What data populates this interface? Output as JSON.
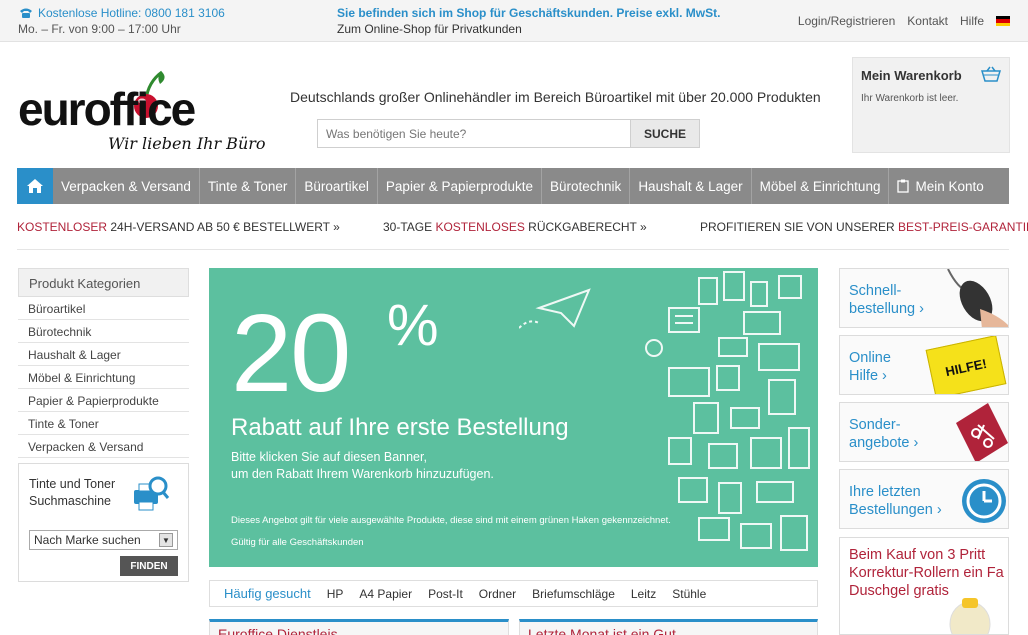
{
  "topbar": {
    "hotline": "Kostenlose Hotline: 0800 181 3106",
    "hours": "Mo. – Fr. von 9:00 – 17:00 Uhr",
    "business_note": "Sie befinden sich im Shop für Geschäftskunden. Preise exkl. MwSt.",
    "private_link": "Zum Online-Shop für Privatkunden",
    "links": [
      "Login/Registrieren",
      "Kontakt",
      "Hilfe"
    ]
  },
  "header": {
    "logo_word": "euroffice",
    "logo_tagline": "Wir lieben Ihr Büro",
    "tagline": "Deutschlands großer Onlinehändler im Bereich Büroartikel mit über 20.000 Produkten",
    "search_placeholder": "Was benötigen Sie heute?",
    "search_button": "SUCHE",
    "cart_title": "Mein Warenkorb",
    "cart_text": "Ihr Warenkorb ist leer."
  },
  "nav": {
    "items": [
      "Verpacken & Versand",
      "Tinte & Toner",
      "Büroartikel",
      "Papier & Papierprodukte",
      "Bürotechnik",
      "Haushalt & Lager",
      "Möbel & Einrichtung"
    ],
    "account": "Mein Konto"
  },
  "usps": [
    {
      "hl": "KOSTENLOSER",
      "rest": " 24H-VERSAND AB 50 € BESTELLWERT »"
    },
    {
      "pre": "30-TAGE ",
      "hl": "KOSTENLOSES",
      "rest": " RÜCKGABERECHT »"
    },
    {
      "pre": "PROFITIEREN SIE VON UNSERER ",
      "hl": "BEST-PREIS-GARANTIE",
      "rest": " »"
    }
  ],
  "sidebar": {
    "title": "Produkt Kategorien",
    "items": [
      "Büroartikel",
      "Bürotechnik",
      "Haushalt & Lager",
      "Möbel & Einrichtung",
      "Papier & Papierprodukte",
      "Tinte & Toner",
      "Verpacken & Versand"
    ],
    "ink_title_1": "Tinte und Toner",
    "ink_title_2": "Suchmaschine",
    "brand_select": "Nach Marke suchen",
    "find_button": "FINDEN"
  },
  "banner": {
    "percent": "20",
    "percent_sign": "%",
    "title": "Rabatt auf Ihre erste Bestellung",
    "sub1": "Bitte klicken Sie auf diesen Banner,",
    "sub2": "um den Rabatt Ihrem Warenkorb hinzuzufügen.",
    "note1": "Dieses Angebot gilt für viele ausgewählte Produkte, diese sind mit einem grünen Haken gekennzeichnet.",
    "note2": "Gültig für alle Geschäftskunden"
  },
  "frequent": {
    "label": "Häufig gesucht",
    "items": [
      "HP",
      "A4 Papier",
      "Post-It",
      "Ordner",
      "Briefumschläge",
      "Leitz",
      "Stühle"
    ]
  },
  "teasers": [
    "Euroffice Dienstleis",
    "Letzte Monat ist ein Gut"
  ],
  "tiles": [
    {
      "l1": "Schnell-",
      "l2": "bestellung ›"
    },
    {
      "l1": "Online",
      "l2": "Hilfe ›",
      "art_text": "HILFE!"
    },
    {
      "l1": "Sonder-",
      "l2": "angebote ›"
    },
    {
      "l1": "Ihre letzten",
      "l2": "Bestellungen ›"
    }
  ],
  "promo": "Beim Kauf von 3 Pritt Korrektur-Rollern ein Fa Duschgel gratis",
  "colors": {
    "accent_blue": "#2a8fc9",
    "brand_red": "#b0233a",
    "banner_green": "#5cc09f",
    "nav_grey": "#8a8a8a"
  }
}
